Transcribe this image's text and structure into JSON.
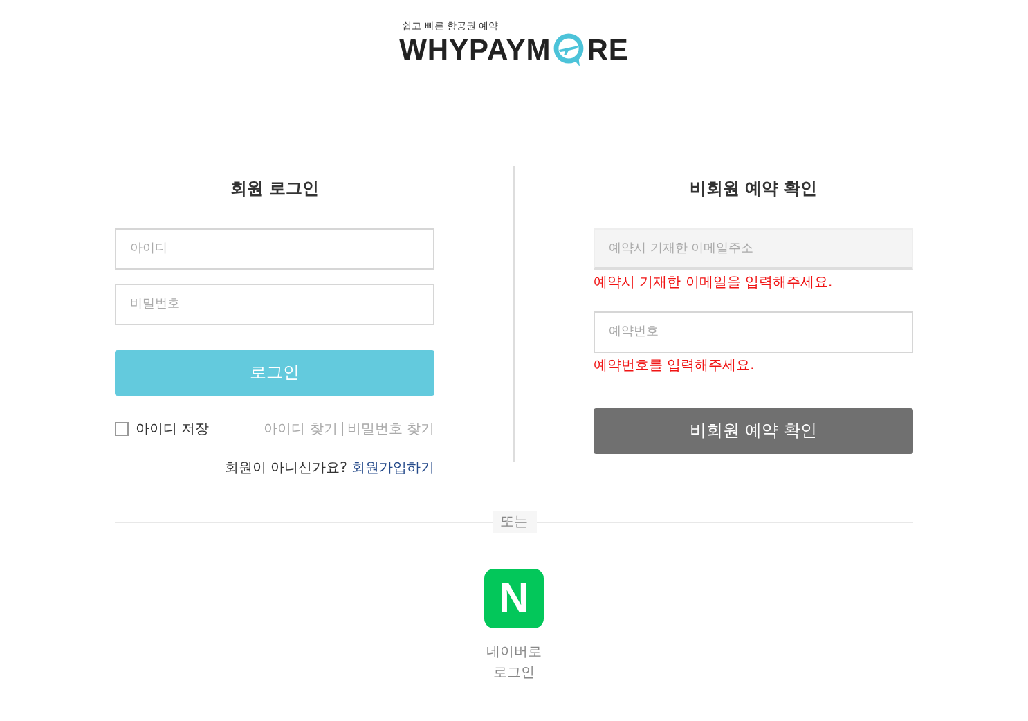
{
  "logo": {
    "tagline": "쉽고 빠른 항공권 예약",
    "word_start": "WHYPAYM",
    "word_end": "RE"
  },
  "member_login": {
    "title": "회원 로그인",
    "id_field": {
      "placeholder": "아이디"
    },
    "password_field": {
      "placeholder": "비밀번호"
    },
    "login_button": "로그인",
    "remember_id": {
      "label": "아이디 저장",
      "checked": false
    },
    "find_links": [
      "아이디 찾기",
      "비밀번호 찾기"
    ],
    "signup_prompt": "회원이 아니신가요?",
    "signup_link": "회원가입하기"
  },
  "guest_check": {
    "title": "비회원 예약 확인",
    "email_field": {
      "placeholder": "예약시 기재한 이메일주소",
      "disabled": true
    },
    "email_error": "예약시 기재한 이메일을 입력해주세요.",
    "booking_field": {
      "placeholder": "예약번호",
      "disabled": false
    },
    "booking_error": "예약번호를 입력해주세요.",
    "check_button": "비회원 예약 확인"
  },
  "divider_label": "또는",
  "naver_login": {
    "icon_letter": "N",
    "label_lines": [
      "네이버로",
      "로그인"
    ]
  }
}
